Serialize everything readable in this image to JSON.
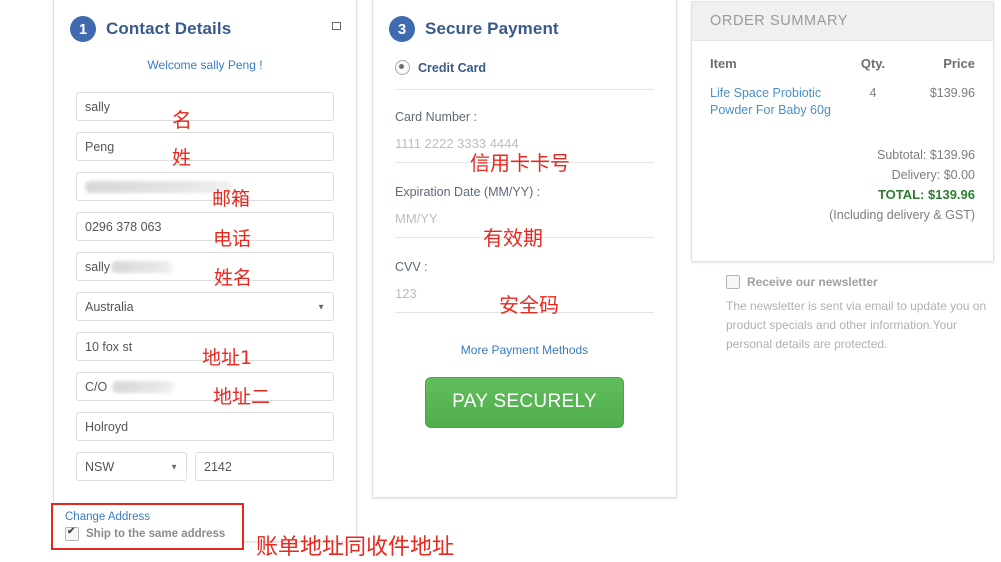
{
  "contact": {
    "step_number": "1",
    "title": "Contact Details",
    "collapse_icon": "collapse-square-icon",
    "welcome": "Welcome sally Peng !",
    "fields": {
      "first_name": "sally",
      "last_name": "Peng",
      "email": "",
      "phone": "0296 378 063",
      "full_name": "sally",
      "country": "Australia",
      "address1": "10 fox st",
      "address2": "C/O",
      "suburb": "Holroyd",
      "state": "NSW",
      "postcode": "2142"
    },
    "change_address_link": "Change Address",
    "ship_same_address": "Ship to the same address"
  },
  "payment": {
    "step_number": "3",
    "title": "Secure Payment",
    "method_label": "Credit Card",
    "card_number_label": "Card Number :",
    "card_number_placeholder": "1111 2222 3333 4444",
    "expiry_label": "Expiration Date (MM/YY) :",
    "expiry_placeholder": "MM/YY",
    "cvv_label": "CVV :",
    "cvv_placeholder": "123",
    "more_methods": "More Payment Methods",
    "pay_button": "PAY SECURELY"
  },
  "order": {
    "heading": "ORDER SUMMARY",
    "columns": {
      "item": "Item",
      "qty": "Qty.",
      "price": "Price"
    },
    "rows": [
      {
        "name": "Life Space Probiotic Powder For Baby 60g",
        "qty": "4",
        "price": "$139.96"
      }
    ],
    "subtotal": "Subtotal: $139.96",
    "delivery": "Delivery: $0.00",
    "total": "TOTAL: $139.96",
    "note": "(Including delivery & GST)"
  },
  "newsletter": {
    "checkbox_label": "Receive our newsletter",
    "description": "The newsletter is sent via email to update you on product specials and other information.Your personal details are protected."
  },
  "annotations": {
    "first_name": "名",
    "last_name": "姓",
    "email": "邮箱",
    "phone": "电话",
    "full_name": "姓名",
    "address1": "地址1",
    "address2": "地址二",
    "billing_same": "账单地址同收件地址",
    "card_number": "信用卡卡号",
    "expiry": "有效期",
    "cvv": "安全码"
  },
  "colors": {
    "accent_blue": "#3f6ab0",
    "link_blue": "#3a7bbf",
    "pay_green": "#54b151",
    "total_green": "#2e7d32",
    "annotation_red": "#e8281e"
  }
}
